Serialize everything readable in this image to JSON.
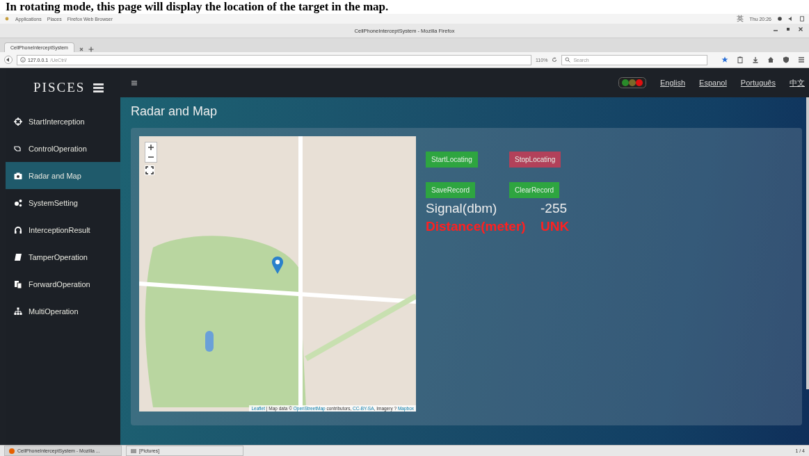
{
  "caption": "In rotating mode, this page will display the location of the target in the map.",
  "desktop_bar": {
    "menus": [
      "Applications",
      "Places",
      "Firefox Web Browser"
    ],
    "input_method": "英",
    "clock": "Thu 20:26"
  },
  "window": {
    "title": "CellPhoneInterceptSystem - Mozilla Firefox"
  },
  "tabs": [
    {
      "label": "CellPhoneInterceptSystem",
      "selected": true
    }
  ],
  "address_bar": {
    "host": "127.0.0.1",
    "path": "/UeCtrl/",
    "zoom": "110%",
    "search_placeholder": "Search"
  },
  "app": {
    "logo": "PISCES",
    "page_title": "Radar and Map",
    "languages": [
      "English",
      "Espanol",
      "Português",
      "中文"
    ],
    "sidebar": [
      {
        "label": "StartInterception",
        "selected": false
      },
      {
        "label": "ControlOperation",
        "selected": false
      },
      {
        "label": "Radar and Map",
        "selected": true
      },
      {
        "label": "SystemSetting",
        "selected": false
      },
      {
        "label": "InterceptionResult",
        "selected": false
      },
      {
        "label": "TamperOperation",
        "selected": false
      },
      {
        "label": "ForwardOperation",
        "selected": false
      },
      {
        "label": "MultiOperation",
        "selected": false
      }
    ],
    "buttons": [
      {
        "label": "StartLocating",
        "kind": "success"
      },
      {
        "label": "StopLocating",
        "kind": "danger"
      },
      {
        "label": "SaveRecord",
        "kind": "success"
      },
      {
        "label": "ClearRecord",
        "kind": "success"
      }
    ],
    "readings": [
      {
        "label": "Signal(dbm)",
        "value": "-255",
        "kind": "normal"
      },
      {
        "label": "Distance(meter)",
        "value": "UNK",
        "kind": "alert"
      }
    ],
    "map_attribution": [
      {
        "text": "Leaflet",
        "link": true
      },
      {
        "text": " | Map data © ",
        "link": false
      },
      {
        "text": "OpenStreetMap",
        "link": true
      },
      {
        "text": " contributors, ",
        "link": false
      },
      {
        "text": "CC-BY-SA",
        "link": true
      },
      {
        "text": ", Imagery ? ",
        "link": false
      },
      {
        "text": "Mapbox",
        "link": true
      }
    ]
  },
  "taskbar": {
    "items": [
      "CellPhoneInterceptSystem - Mozilla ...",
      "[Pictures]"
    ],
    "pager": "1 / 4"
  }
}
